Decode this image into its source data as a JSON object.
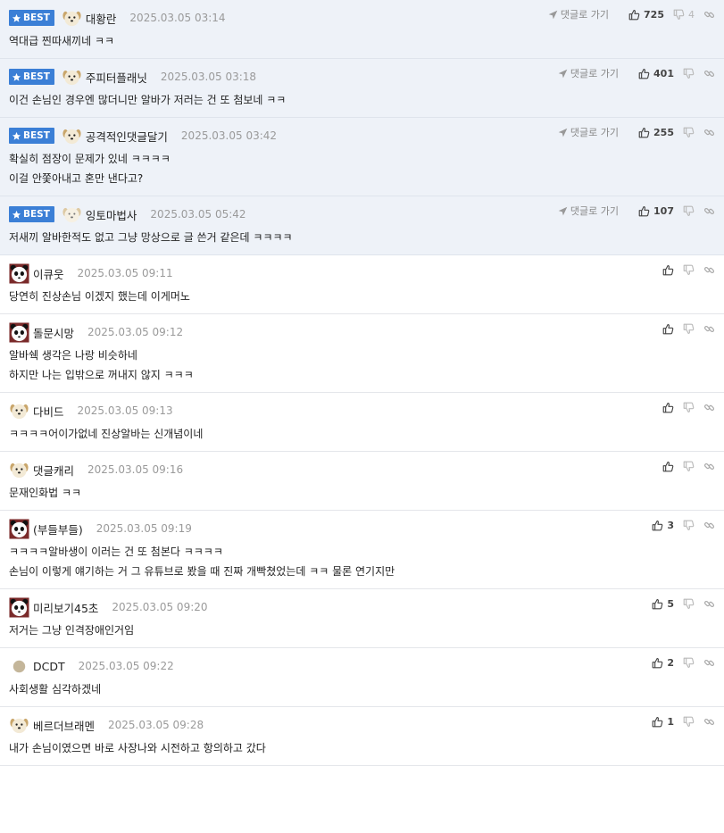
{
  "best_label": "BEST",
  "reply_label": "댓글로 가기",
  "colors": {
    "best_bg": "#eef2f8",
    "badge": "#3b7fd6"
  },
  "comments": [
    {
      "best": true,
      "avatar": "dog-face",
      "nick": "대황란",
      "date": "2025.03.05 03:14",
      "lines": [
        "역대급 찐따새끼네 ㅋㅋ"
      ],
      "up": "725",
      "down": "4"
    },
    {
      "best": true,
      "avatar": "dog-face",
      "nick": "주피터플래닛",
      "date": "2025.03.05 03:18",
      "lines": [
        "이건 손님인 경우엔 많더니만 알바가 저러는 건 또 첨보네 ㅋㅋ"
      ],
      "up": "401",
      "down": ""
    },
    {
      "best": true,
      "avatar": "dog-face",
      "nick": "공격적인댓글달기",
      "date": "2025.03.05 03:42",
      "lines": [
        "확실히 점장이 문제가 있네 ㅋㅋㅋㅋ",
        "이걸 안쫓아내고 혼만 낸다고?"
      ],
      "up": "255",
      "down": ""
    },
    {
      "best": true,
      "avatar": "dog-face-light",
      "nick": "잉토마법사",
      "date": "2025.03.05 05:42",
      "lines": [
        "저새끼 알바한적도 없고 그냥 망상으로 글 쓴거 같은데 ㅋㅋㅋㅋ"
      ],
      "up": "107",
      "down": ""
    },
    {
      "best": false,
      "avatar": "panda-face",
      "nick": "이큐웃",
      "date": "2025.03.05 09:11",
      "lines": [
        "당연히 진상손님 이겠지 했는데 이게머노"
      ],
      "up": "",
      "down": ""
    },
    {
      "best": false,
      "avatar": "panda-face",
      "nick": "돌문시망",
      "date": "2025.03.05 09:12",
      "lines": [
        "알바쉑 생각은 나랑 비슷하네",
        "하지만 나는 입밖으로 꺼내지 않지 ㅋㅋㅋ"
      ],
      "up": "",
      "down": ""
    },
    {
      "best": false,
      "avatar": "dog-face",
      "nick": "다비드",
      "date": "2025.03.05 09:13",
      "lines": [
        "ㅋㅋㅋㅋ어이가없네 진상알바는 신개념이네"
      ],
      "up": "",
      "down": ""
    },
    {
      "best": false,
      "avatar": "dog-face",
      "nick": "댓글캐리",
      "date": "2025.03.05 09:16",
      "lines": [
        "문재인화법 ㅋㅋ"
      ],
      "up": "",
      "down": ""
    },
    {
      "best": false,
      "avatar": "panda-face",
      "nick": "(부들부들)",
      "date": "2025.03.05 09:19",
      "lines": [
        "ㅋㅋㅋㅋ알바생이 이러는 건 또 첨본다 ㅋㅋㅋㅋ",
        "손님이 이렇게 얘기하는 거 그 유튜브로 봤을 때 진짜 개빡쳤었는데 ㅋㅋ 물론 연기지만"
      ],
      "up": "3",
      "down": ""
    },
    {
      "best": false,
      "avatar": "panda-face",
      "nick": "미리보기45초",
      "date": "2025.03.05 09:20",
      "lines": [
        "저거는 그냥 인격장애인거임"
      ],
      "up": "5",
      "down": ""
    },
    {
      "best": false,
      "avatar": "circle",
      "nick": "DCDT",
      "date": "2025.03.05 09:22",
      "lines": [
        "사회생활 심각하겠네"
      ],
      "up": "2",
      "down": ""
    },
    {
      "best": false,
      "avatar": "dog-face",
      "nick": "베르더브래멘",
      "date": "2025.03.05 09:28",
      "lines": [
        "내가 손님이였으면 바로 사장나와 시전하고 항의하고 갔다"
      ],
      "up": "1",
      "down": ""
    }
  ]
}
